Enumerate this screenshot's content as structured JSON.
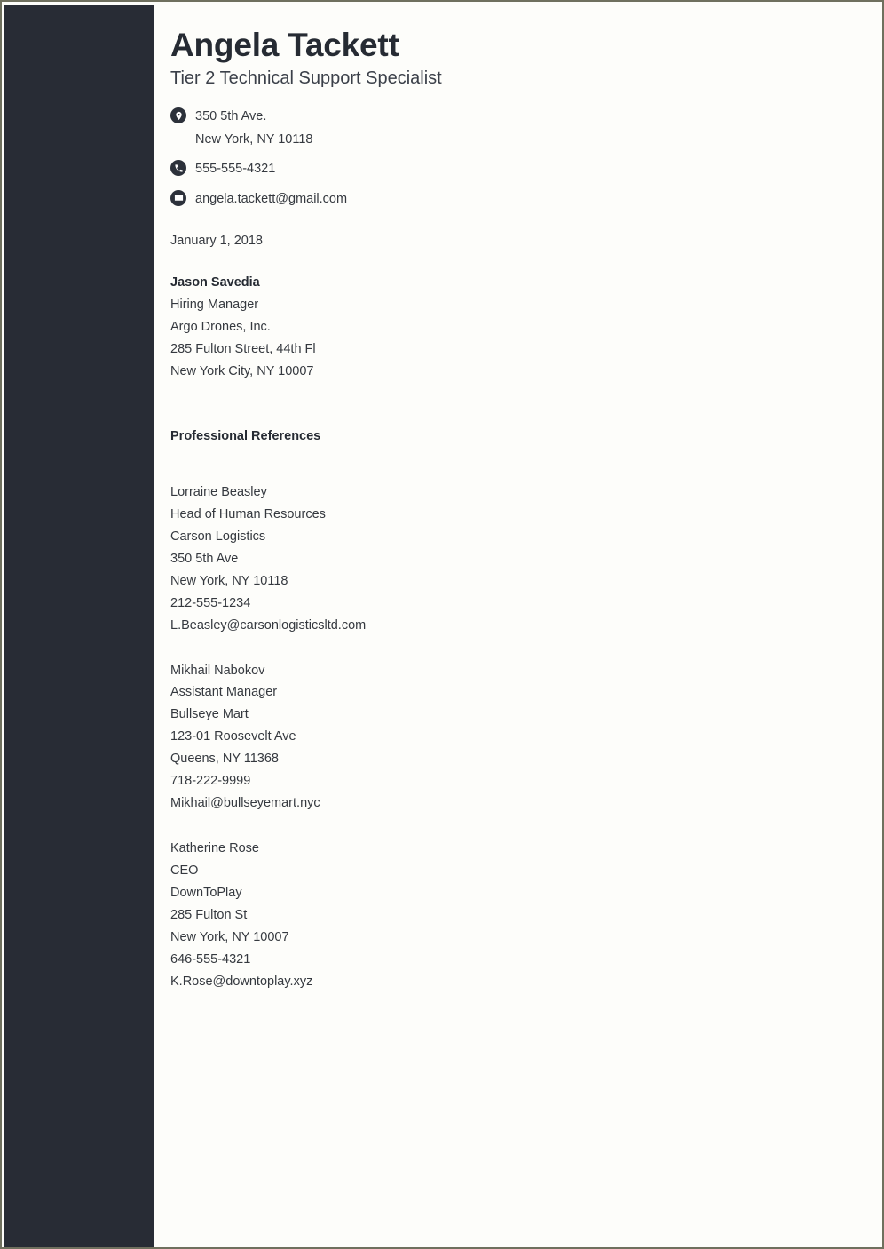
{
  "document": {
    "type": "reference-page",
    "colors": {
      "sidebar": "#282c35",
      "page_background": "#fdfdfa",
      "page_border": "#6f705e",
      "heading_text": "#262b33",
      "body_text": "#35393f"
    }
  },
  "header": {
    "name": "Angela Tackett",
    "headline": "Tier 2 Technical Support Specialist"
  },
  "contact": [
    {
      "icon": "location-pin-icon",
      "line1": "350 5th Ave.",
      "line2": "New York, NY 10118"
    },
    {
      "icon": "phone-icon",
      "line1": "555-555-4321",
      "line2": ""
    },
    {
      "icon": "envelope-icon",
      "line1": "angela.tackett@gmail.com",
      "line2": ""
    }
  ],
  "date": "January 1, 2018",
  "recipient": {
    "name": "Jason Savedia",
    "title": "Hiring Manager",
    "company": "Argo Drones, Inc.",
    "address": "285 Fulton Street, 44th Fl",
    "city_state_zip": "New York City, NY 10007"
  },
  "section": {
    "title": "Professional References"
  },
  "references": [
    {
      "name": "Lorraine Beasley",
      "title": "Head of Human Resources",
      "company": "Carson Logistics",
      "address": "350 5th Ave",
      "city_state_zip": "New York, NY 10118",
      "phone": "212-555-1234",
      "email": "L.Beasley@carsonlogisticsltd.com"
    },
    {
      "name": "Mikhail Nabokov",
      "title": "Assistant Manager",
      "company": "Bullseye Mart",
      "address": "123-01 Roosevelt Ave",
      "city_state_zip": "Queens, NY 11368",
      "phone": "718-222-9999",
      "email": "Mikhail@bullseyemart.nyc"
    },
    {
      "name": "Katherine Rose",
      "title": "CEO",
      "company": "DownToPlay",
      "address": "285 Fulton St",
      "city_state_zip": "New York, NY 10007",
      "phone": "646-555-4321",
      "email": "K.Rose@downtoplay.xyz"
    }
  ]
}
